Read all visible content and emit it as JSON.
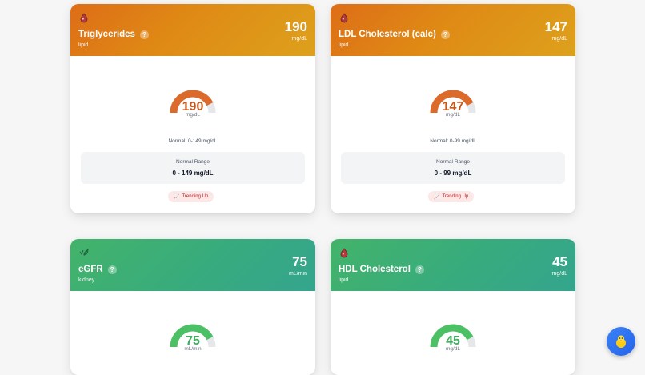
{
  "cards": [
    {
      "title": "Triglycerides",
      "help": "?",
      "category": "lipid",
      "value": "190",
      "unit": "mg/dL",
      "gauge_fraction": 0.85,
      "normal_text": "Normal: 0-149 mg/dL",
      "range_title": "Normal Range",
      "range_value": "0 - 149 mg/dL",
      "trend": "Trending Up",
      "icon": "lipid-icon",
      "color": "#de6d17"
    },
    {
      "title": "LDL Cholesterol (calc)",
      "help": "?",
      "category": "lipid",
      "value": "147",
      "unit": "mg/dL",
      "gauge_fraction": 0.85,
      "normal_text": "Normal: 0-99 mg/dL",
      "range_title": "Normal Range",
      "range_value": "0 - 99 mg/dL",
      "trend": "Trending Up",
      "icon": "lipid-icon",
      "color": "#df8a15"
    },
    {
      "title": "eGFR",
      "help": "?",
      "category": "kidney",
      "value": "75",
      "unit": "mL/min",
      "gauge_fraction": 0.85,
      "icon": "kidney-icon",
      "color": "#43b36a"
    },
    {
      "title": "HDL Cholesterol",
      "help": "?",
      "category": "lipid",
      "value": "45",
      "unit": "mg/dL",
      "gauge_fraction": 0.85,
      "icon": "lipid-icon",
      "color": "#38ab7e"
    }
  ],
  "fab": {
    "icon": "assistant-avatar-icon"
  }
}
